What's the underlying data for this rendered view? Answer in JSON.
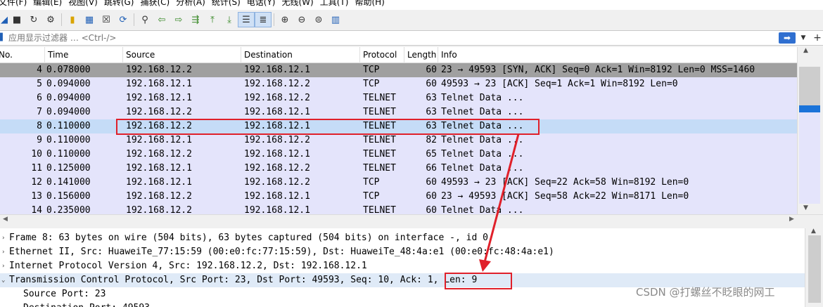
{
  "menu": [
    "文件(F)",
    "编辑(E)",
    "视图(V)",
    "跳转(G)",
    "捕获(C)",
    "分析(A)",
    "统计(S)",
    "电话(Y)",
    "无线(W)",
    "工具(T)",
    "帮助(H)"
  ],
  "filter": {
    "placeholder": "应用显示过滤器 … <Ctrl-/>"
  },
  "columns": {
    "no": "No.",
    "time": "Time",
    "source": "Source",
    "destination": "Destination",
    "protocol": "Protocol",
    "length": "Length",
    "info": "Info"
  },
  "packets": [
    {
      "no": "4",
      "time": "0.078000",
      "source": "192.168.12.2",
      "destination": "192.168.12.1",
      "protocol": "TCP",
      "length": "60",
      "info": "23 → 49593 [SYN, ACK] Seq=0 Ack=1 Win=8192 Len=0 MSS=1460"
    },
    {
      "no": "5",
      "time": "0.094000",
      "source": "192.168.12.1",
      "destination": "192.168.12.2",
      "protocol": "TCP",
      "length": "60",
      "info": "49593 → 23 [ACK] Seq=1 Ack=1 Win=8192 Len=0"
    },
    {
      "no": "6",
      "time": "0.094000",
      "source": "192.168.12.1",
      "destination": "192.168.12.2",
      "protocol": "TELNET",
      "length": "63",
      "info": "Telnet Data ..."
    },
    {
      "no": "7",
      "time": "0.094000",
      "source": "192.168.12.2",
      "destination": "192.168.12.1",
      "protocol": "TELNET",
      "length": "63",
      "info": "Telnet Data ..."
    },
    {
      "no": "8",
      "time": "0.110000",
      "source": "192.168.12.2",
      "destination": "192.168.12.1",
      "protocol": "TELNET",
      "length": "63",
      "info": "Telnet Data ..."
    },
    {
      "no": "9",
      "time": "0.110000",
      "source": "192.168.12.1",
      "destination": "192.168.12.2",
      "protocol": "TELNET",
      "length": "82",
      "info": "Telnet Data ..."
    },
    {
      "no": "10",
      "time": "0.110000",
      "source": "192.168.12.2",
      "destination": "192.168.12.1",
      "protocol": "TELNET",
      "length": "65",
      "info": "Telnet Data ..."
    },
    {
      "no": "11",
      "time": "0.125000",
      "source": "192.168.12.1",
      "destination": "192.168.12.2",
      "protocol": "TELNET",
      "length": "66",
      "info": "Telnet Data ..."
    },
    {
      "no": "12",
      "time": "0.141000",
      "source": "192.168.12.1",
      "destination": "192.168.12.2",
      "protocol": "TCP",
      "length": "60",
      "info": "49593 → 23 [ACK] Seq=22 Ack=58 Win=8192 Len=0"
    },
    {
      "no": "13",
      "time": "0.156000",
      "source": "192.168.12.2",
      "destination": "192.168.12.1",
      "protocol": "TCP",
      "length": "60",
      "info": "23 → 49593 [ACK] Seq=58 Ack=22 Win=8171 Len=0"
    },
    {
      "no": "14",
      "time": "0.235000",
      "source": "192.168.12.2",
      "destination": "192.168.12.1",
      "protocol": "TELNET",
      "length": "60",
      "info": "Telnet Data ..."
    }
  ],
  "details": [
    {
      "text": "Frame 8: 63 bytes on wire (504 bits), 63 bytes captured (504 bits) on interface -, id 0"
    },
    {
      "text": "Ethernet II, Src: HuaweiTe_77:15:59 (00:e0:fc:77:15:59), Dst: HuaweiTe_48:4a:e1 (00:e0:fc:48:4a:e1)"
    },
    {
      "text": "Internet Protocol Version 4, Src: 192.168.12.2, Dst: 192.168.12.1"
    },
    {
      "text": "Transmission Control Protocol, Src Port: 23, Dst Port: 49593, Seq: 10, Ack: 1, Len: 9"
    },
    {
      "text": "Source Port: 23"
    },
    {
      "text": "Destination Port: 49593"
    }
  ],
  "watermark": "CSDN @打螺丝不眨眼的网工",
  "colors": {
    "row_bg": "#e4e4fb",
    "row_syn": "#a0a0a0",
    "row_selected": "#c5dcf7",
    "annotation": "#e0202a"
  }
}
